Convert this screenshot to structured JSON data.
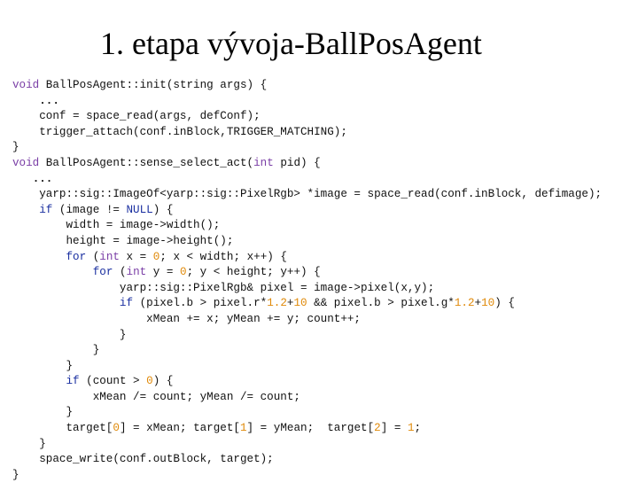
{
  "slide": {
    "title": "1. etapa vývoja-BallPosAgent"
  },
  "code": {
    "lines": [
      [
        {
          "t": "void",
          "c": "kw"
        },
        {
          "t": " BallPosAgent::init(string args) {"
        }
      ],
      [
        {
          "t": "    "
        },
        {
          "t": "...",
          "c": "ellipsis"
        }
      ],
      [
        {
          "t": "    conf = space_read(args, defConf);"
        }
      ],
      [
        {
          "t": "    trigger_attach(conf.inBlock,TRIGGER_MATCHING);"
        }
      ],
      [
        {
          "t": "}"
        }
      ],
      [
        {
          "t": "void",
          "c": "kw"
        },
        {
          "t": " BallPosAgent::sense_select_act("
        },
        {
          "t": "int",
          "c": "kw"
        },
        {
          "t": " pid) {"
        }
      ],
      [
        {
          "t": "   "
        },
        {
          "t": "...",
          "c": "ellipsis"
        }
      ],
      [
        {
          "t": "    yarp::sig::ImageOf<yarp::sig::PixelRgb> *image = space_read(conf.inBlock, defimage);"
        }
      ],
      [
        {
          "t": "    "
        },
        {
          "t": "if",
          "c": "kwb"
        },
        {
          "t": " (image != "
        },
        {
          "t": "NULL",
          "c": "kwb"
        },
        {
          "t": ") {"
        }
      ],
      [
        {
          "t": "        width = image->width();"
        }
      ],
      [
        {
          "t": "        height = image->height();"
        }
      ],
      [
        {
          "t": "        "
        },
        {
          "t": "for",
          "c": "kwb"
        },
        {
          "t": " ("
        },
        {
          "t": "int",
          "c": "kw"
        },
        {
          "t": " x = "
        },
        {
          "t": "0",
          "c": "num"
        },
        {
          "t": "; x < width; x++) {"
        }
      ],
      [
        {
          "t": "            "
        },
        {
          "t": "for",
          "c": "kwb"
        },
        {
          "t": " ("
        },
        {
          "t": "int",
          "c": "kw"
        },
        {
          "t": " y = "
        },
        {
          "t": "0",
          "c": "num"
        },
        {
          "t": "; y < height; y++) {"
        }
      ],
      [
        {
          "t": "                yarp::sig::PixelRgb& pixel = image->pixel(x,y);"
        }
      ],
      [
        {
          "t": "                "
        },
        {
          "t": "if",
          "c": "kwb"
        },
        {
          "t": " (pixel.b > pixel.r*"
        },
        {
          "t": "1.2",
          "c": "num"
        },
        {
          "t": "+"
        },
        {
          "t": "10",
          "c": "num"
        },
        {
          "t": " && pixel.b > pixel.g*"
        },
        {
          "t": "1.2",
          "c": "num"
        },
        {
          "t": "+"
        },
        {
          "t": "10",
          "c": "num"
        },
        {
          "t": ") {"
        }
      ],
      [
        {
          "t": "                    xMean += x; yMean += y; count++;"
        }
      ],
      [
        {
          "t": "                }"
        }
      ],
      [
        {
          "t": "            }"
        }
      ],
      [
        {
          "t": "        }"
        }
      ],
      [
        {
          "t": "        "
        },
        {
          "t": "if",
          "c": "kwb"
        },
        {
          "t": " (count > "
        },
        {
          "t": "0",
          "c": "num"
        },
        {
          "t": ") {"
        }
      ],
      [
        {
          "t": "            xMean /= count; yMean /= count;"
        }
      ],
      [
        {
          "t": "        }"
        }
      ],
      [
        {
          "t": "        target["
        },
        {
          "t": "0",
          "c": "num"
        },
        {
          "t": "] = xMean; target["
        },
        {
          "t": "1",
          "c": "num"
        },
        {
          "t": "] = yMean;  target["
        },
        {
          "t": "2",
          "c": "num"
        },
        {
          "t": "] = "
        },
        {
          "t": "1",
          "c": "num"
        },
        {
          "t": ";"
        }
      ],
      [
        {
          "t": "    }"
        }
      ],
      [
        {
          "t": "    space_write(conf.outBlock, target);"
        }
      ],
      [
        {
          "t": "}"
        }
      ]
    ]
  },
  "colors": {
    "keyword_type": "#7a3ea6",
    "keyword_control": "#1a2fa0",
    "number": "#e08a0a"
  }
}
